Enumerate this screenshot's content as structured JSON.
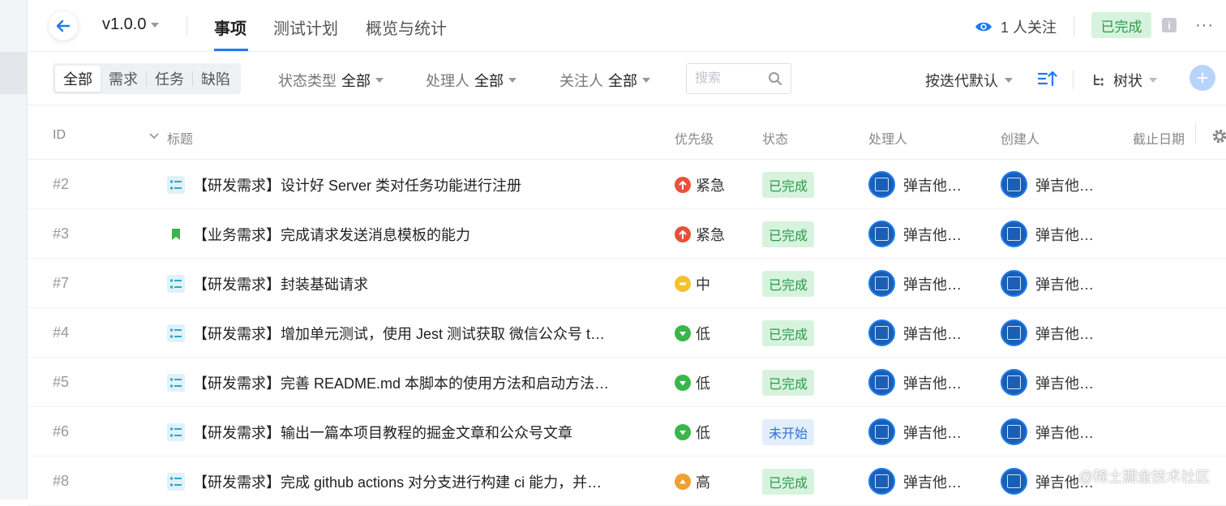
{
  "header": {
    "version": "v1.0.0",
    "tabs": [
      "事项",
      "测试计划",
      "概览与统计"
    ],
    "watch_text": "1 人关注",
    "status": "已完成",
    "info_glyph": "i",
    "more_glyph": "···"
  },
  "filters": {
    "segments": [
      "全部",
      "需求",
      "任务",
      "缺陷"
    ],
    "status_type": {
      "label": "状态类型",
      "value": "全部"
    },
    "handler": {
      "label": "处理人",
      "value": "全部"
    },
    "follower": {
      "label": "关注人",
      "value": "全部"
    },
    "search_placeholder": "搜索",
    "sort_label": "按迭代默认",
    "view_label": "树状",
    "add_glyph": "+"
  },
  "table": {
    "headers": {
      "id": "ID",
      "title": "标题",
      "priority": "优先级",
      "status": "状态",
      "handler": "处理人",
      "creator": "创建人",
      "deadline": "截止日期"
    },
    "rows": [
      {
        "id": "#2",
        "type": "req",
        "title": "【研发需求】设计好 Server 类对任务功能进行注册",
        "priority": "紧急",
        "pri_kind": "urgent",
        "status": "已完成",
        "status_kind": "done",
        "handler": "弹吉他…",
        "creator": "弹吉他…"
      },
      {
        "id": "#3",
        "type": "biz",
        "title": "【业务需求】完成请求发送消息模板的能力",
        "priority": "紧急",
        "pri_kind": "urgent",
        "status": "已完成",
        "status_kind": "done",
        "handler": "弹吉他…",
        "creator": "弹吉他…"
      },
      {
        "id": "#7",
        "type": "req",
        "title": "【研发需求】封装基础请求",
        "priority": "中",
        "pri_kind": "medium",
        "status": "已完成",
        "status_kind": "done",
        "handler": "弹吉他…",
        "creator": "弹吉他…"
      },
      {
        "id": "#4",
        "type": "req",
        "title": "【研发需求】增加单元测试，使用 Jest 测试获取 微信公众号 t…",
        "priority": "低",
        "pri_kind": "low",
        "status": "已完成",
        "status_kind": "done",
        "handler": "弹吉他…",
        "creator": "弹吉他…"
      },
      {
        "id": "#5",
        "type": "req",
        "title": "【研发需求】完善 README.md 本脚本的使用方法和启动方法…",
        "priority": "低",
        "pri_kind": "low",
        "status": "已完成",
        "status_kind": "done",
        "handler": "弹吉他…",
        "creator": "弹吉他…"
      },
      {
        "id": "#6",
        "type": "req",
        "title": "【研发需求】输出一篇本项目教程的掘金文章和公众号文章",
        "priority": "低",
        "pri_kind": "low",
        "status": "未开始",
        "status_kind": "todo",
        "handler": "弹吉他…",
        "creator": "弹吉他…"
      },
      {
        "id": "#8",
        "type": "req",
        "title": "【研发需求】完成 github actions 对分支进行构建 ci 能力，并…",
        "priority": "高",
        "pri_kind": "high",
        "status": "已完成",
        "status_kind": "done",
        "handler": "弹吉他…",
        "creator": "弹吉他…"
      }
    ]
  },
  "watermark": "@稀土掘金技术社区",
  "colors": {
    "accent": "#1e7bf0",
    "done_bg": "#d7f3de",
    "done_fg": "#2b9a4a",
    "todo_bg": "#e3eefc",
    "todo_fg": "#2f6fd6",
    "urgent": "#e8503a",
    "high": "#f0a030",
    "medium": "#f5c22e",
    "low": "#3bb54a"
  }
}
